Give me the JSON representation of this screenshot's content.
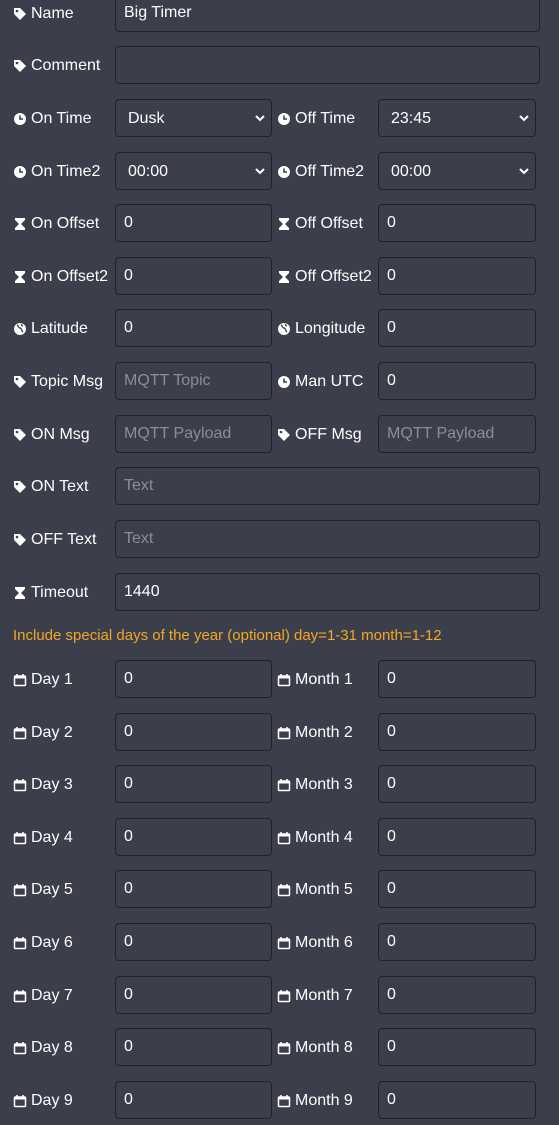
{
  "fields": {
    "name": {
      "label": "Name",
      "value": "Big Timer"
    },
    "comment": {
      "label": "Comment",
      "value": ""
    },
    "on_time": {
      "label": "On Time",
      "value": "Dusk"
    },
    "off_time": {
      "label": "Off Time",
      "value": "23:45"
    },
    "on_time2": {
      "label": "On Time2",
      "value": "00:00"
    },
    "off_time2": {
      "label": "Off Time2",
      "value": "00:00"
    },
    "on_offset": {
      "label": "On Offset",
      "value": "0"
    },
    "off_offset": {
      "label": "Off Offset",
      "value": "0"
    },
    "on_offset2": {
      "label": "On Offset2",
      "value": "0"
    },
    "off_offset2": {
      "label": "Off Offset2",
      "value": "0"
    },
    "latitude": {
      "label": "Latitude",
      "value": "0"
    },
    "longitude": {
      "label": "Longitude",
      "value": "0"
    },
    "topic_msg": {
      "label": "Topic Msg",
      "value": "",
      "placeholder": "MQTT Topic"
    },
    "man_utc": {
      "label": "Man UTC",
      "value": "0"
    },
    "on_msg": {
      "label": "ON Msg",
      "value": "",
      "placeholder": "MQTT Payload"
    },
    "off_msg": {
      "label": "OFF Msg",
      "value": "",
      "placeholder": "MQTT Payload"
    },
    "on_text": {
      "label": "ON Text",
      "value": "",
      "placeholder": "Text"
    },
    "off_text": {
      "label": "OFF Text",
      "value": "",
      "placeholder": "Text"
    },
    "timeout": {
      "label": "Timeout",
      "value": "1440"
    }
  },
  "special_days_notice": "Include special days of the year (optional) day=1-31 month=1-12",
  "special_days": [
    {
      "day_label": "Day 1",
      "day_value": "0",
      "month_label": "Month 1",
      "month_value": "0"
    },
    {
      "day_label": "Day 2",
      "day_value": "0",
      "month_label": "Month 2",
      "month_value": "0"
    },
    {
      "day_label": "Day 3",
      "day_value": "0",
      "month_label": "Month 3",
      "month_value": "0"
    },
    {
      "day_label": "Day 4",
      "day_value": "0",
      "month_label": "Month 4",
      "month_value": "0"
    },
    {
      "day_label": "Day 5",
      "day_value": "0",
      "month_label": "Month 5",
      "month_value": "0"
    },
    {
      "day_label": "Day 6",
      "day_value": "0",
      "month_label": "Month 6",
      "month_value": "0"
    },
    {
      "day_label": "Day 7",
      "day_value": "0",
      "month_label": "Month 7",
      "month_value": "0"
    },
    {
      "day_label": "Day 8",
      "day_value": "0",
      "month_label": "Month 8",
      "month_value": "0"
    },
    {
      "day_label": "Day 9",
      "day_value": "0",
      "month_label": "Month 9",
      "month_value": "0"
    }
  ],
  "icons": {
    "tag": "tag-icon",
    "clock": "clock-icon",
    "hourglass": "hourglass-icon",
    "globe": "globe-icon",
    "calendar": "calendar-icon"
  },
  "colors": {
    "background": "#3b3f4c",
    "notice": "#f5a623",
    "placeholder": "#8a8e98"
  }
}
